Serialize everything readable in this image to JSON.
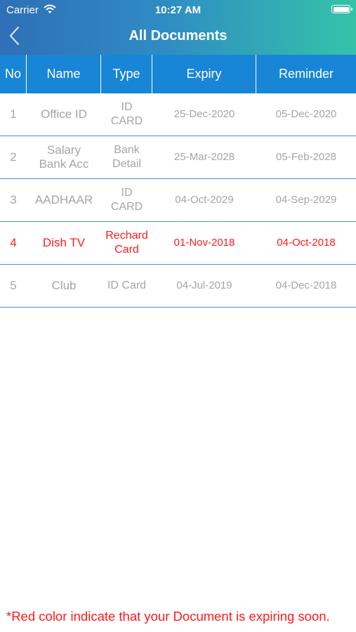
{
  "status_bar": {
    "carrier": "Carrier",
    "time": "10:27 AM"
  },
  "nav": {
    "title": "All Documents",
    "back_icon": "chevron-left-icon"
  },
  "table": {
    "headers": [
      "No",
      "Name",
      "Type",
      "Expiry",
      "Reminder"
    ],
    "rows": [
      {
        "no": "1",
        "name": "Office ID",
        "type": "ID\nCARD",
        "expiry": "25-Dec-2020",
        "reminder": "05-Dec-2020",
        "alert": false
      },
      {
        "no": "2",
        "name": "Salary\nBank Acc",
        "type": "Bank\nDetail",
        "expiry": "25-Mar-2028",
        "reminder": "05-Feb-2028",
        "alert": false
      },
      {
        "no": "3",
        "name": "AADHAAR",
        "type": "ID\nCARD",
        "expiry": "04-Oct-2029",
        "reminder": "04-Sep-2029",
        "alert": false
      },
      {
        "no": "4",
        "name": "Dish TV",
        "type": "Rechard\nCard",
        "expiry": "01-Nov-2018",
        "reminder": "04-Oct-2018",
        "alert": true
      },
      {
        "no": "5",
        "name": "Club",
        "type": "ID Card",
        "expiry": "04-Jul-2019",
        "reminder": "04-Dec-2018",
        "alert": false
      }
    ]
  },
  "footer_note": "*Red color indicate that your Document is expiring soon.",
  "colors": {
    "header_start": "#2f6fb7",
    "header_end": "#34c3a9",
    "table_header": "#1985d6",
    "alert": "#ff1a1a",
    "normal_text": "#a5a5a5"
  }
}
